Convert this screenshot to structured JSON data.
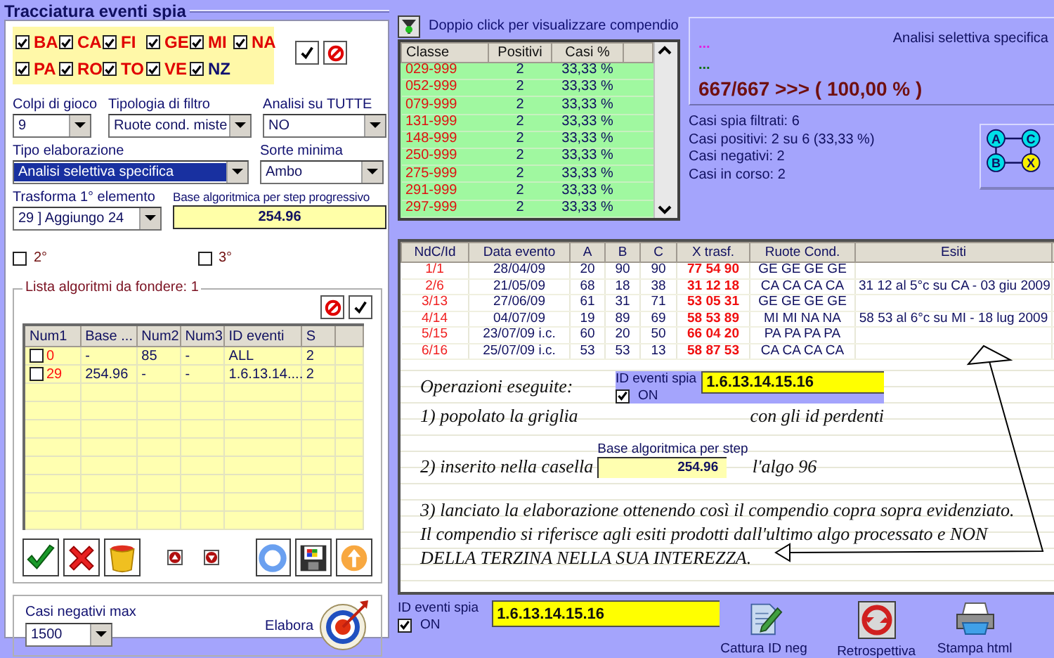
{
  "window": {
    "title": "Tracciatura eventi spia"
  },
  "wheels": [
    {
      "label": "BA",
      "checked": true,
      "color": "#e00000"
    },
    {
      "label": "CA",
      "checked": true,
      "color": "#e00000"
    },
    {
      "label": "FI",
      "checked": true,
      "color": "#e00000"
    },
    {
      "label": "GE",
      "checked": true,
      "color": "#e00000"
    },
    {
      "label": "MI",
      "checked": true,
      "color": "#e00000"
    },
    {
      "label": "NA",
      "checked": true,
      "color": "#e00000"
    },
    {
      "label": "PA",
      "checked": true,
      "color": "#e00000"
    },
    {
      "label": "RO",
      "checked": true,
      "color": "#e00000"
    },
    {
      "label": "TO",
      "checked": true,
      "color": "#e00000"
    },
    {
      "label": "VE",
      "checked": true,
      "color": "#e00000"
    },
    {
      "label": "NZ",
      "checked": true,
      "color": "#101070"
    }
  ],
  "filters": [
    {
      "label": "Colpi di gioco",
      "value": "9",
      "highlighted": false
    },
    {
      "label": "Tipologia di filtro",
      "value": "Ruote cond. miste",
      "highlighted": false
    },
    {
      "label": "Analisi su TUTTE",
      "value": "NO",
      "highlighted": false
    },
    {
      "label": "Tipo elaborazione",
      "value": "Analisi selettiva specifica",
      "highlighted": true
    },
    {
      "label": "Sorte minima",
      "value": "Ambo",
      "highlighted": false
    },
    {
      "label": "Trasforma 1° elemento",
      "value": "29 ] Aggiungo 24",
      "highlighted": false
    }
  ],
  "base_step": {
    "label": "Base algoritmica per step progressivo",
    "value": "254.96"
  },
  "extra_checks": [
    {
      "label": "2°",
      "checked": false
    },
    {
      "label": "3°",
      "checked": false
    }
  ],
  "algo_list": {
    "title": "Lista algoritmi da fondere: 1",
    "columns": [
      "Num1",
      "Base ...",
      "Num2",
      "Num3",
      "ID eventi",
      "S"
    ],
    "rows": [
      {
        "checked": false,
        "cells": [
          "0",
          "-",
          "85",
          "-",
          "ALL",
          "2"
        ]
      },
      {
        "checked": false,
        "cells": [
          "29",
          "254.96",
          "-",
          "-",
          "1.6.13.14....",
          "2"
        ]
      }
    ]
  },
  "casi_negativi": {
    "label": "Casi negativi max",
    "value": "1500"
  },
  "elabora": {
    "label": "Elabora"
  },
  "hint": "Doppio click per visualizzare compendio",
  "classes": {
    "columns": [
      "Classe",
      "Positivi",
      "Casi %"
    ],
    "rows": [
      [
        "029-999",
        "2",
        "33,33 %"
      ],
      [
        "052-999",
        "2",
        "33,33 %"
      ],
      [
        "079-999",
        "2",
        "33,33 %"
      ],
      [
        "131-999",
        "2",
        "33,33 %"
      ],
      [
        "148-999",
        "2",
        "33,33 %"
      ],
      [
        "250-999",
        "2",
        "33,33 %"
      ],
      [
        "275-999",
        "2",
        "33,33 %"
      ],
      [
        "291-999",
        "2",
        "33,33 %"
      ],
      [
        "297-999",
        "2",
        "33,33 %"
      ]
    ]
  },
  "summary": {
    "mode": "Analisi selettiva specifica",
    "line1": "...",
    "line2": "...",
    "ratio": "667/667 >>> ( 100,00 % )"
  },
  "stats": [
    "Casi spia filtrati: 6",
    "Casi positivi: 2 su 6 (33,33 %)",
    "Casi negativi: 2",
    "Casi in corso: 2"
  ],
  "diagram": {
    "nodes": [
      {
        "label": "A",
        "color": "#00e0e8"
      },
      {
        "label": "C",
        "color": "#00e0e8"
      },
      {
        "label": "B",
        "color": "#00e0e8"
      },
      {
        "label": "X",
        "color": "#f8f000"
      }
    ]
  },
  "events": {
    "columns": [
      "NdC/Id",
      "Data evento",
      "A",
      "B",
      "C",
      "X trasf.",
      "Ruote Cond.",
      "Esiti"
    ],
    "rows": [
      [
        "1/1",
        "28/04/09",
        "20",
        "90",
        "90",
        "77 54 90",
        "GE GE GE GE",
        ""
      ],
      [
        "2/6",
        "21/05/09",
        "68",
        "18",
        "38",
        "31 12 18",
        "CA CA CA CA",
        "31 12 al 5°c su CA - 03 giu 2009"
      ],
      [
        "3/13",
        "27/06/09",
        "61",
        "31",
        "71",
        "53 05 31",
        "GE GE GE GE",
        ""
      ],
      [
        "4/14",
        "04/07/09",
        "19",
        "89",
        "69",
        "58 53 89",
        "MI MI NA NA",
        "58 53 al 6°c su MI - 18 lug 2009"
      ],
      [
        "5/15",
        "23/07/09 i.c.",
        "60",
        "20",
        "50",
        "66 04 20",
        "PA PA PA PA",
        ""
      ],
      [
        "6/16",
        "25/07/09 i.c.",
        "53",
        "53",
        "13",
        "58 87 53",
        "CA CA CA CA",
        ""
      ]
    ]
  },
  "notes": {
    "heading": "Operazioni eseguite:",
    "step1": "1) popolato la griglia",
    "step1_tail": "con gli id perdenti",
    "step2": "2) inserito nella casella",
    "step2_tail": "l'algo 96",
    "step3_lines": [
      "3) lanciato la elaborazione ottenendo così il compendio copra sopra evidenziato.",
      "Il compendio si riferisce agli esiti prodotti dall'ultimo algo processato e NON",
      "DELLA TERZINA NELLA SUA INTEREZZA."
    ],
    "id_field": {
      "label": "ID eventi spia",
      "value": "1.6.13.14.15.16",
      "on_label": "ON",
      "checked": true
    },
    "base_field": {
      "label": "Base algoritmica per step",
      "value": "254.96"
    }
  },
  "bottom": {
    "id_field": {
      "label": "ID eventi spia",
      "value": "1.6.13.14.15.16",
      "on_label": "ON",
      "checked": true
    },
    "buttons": [
      {
        "label": "Cattura ID neg",
        "kind": "capture"
      },
      {
        "label": "Retrospettiva",
        "kind": "refresh"
      },
      {
        "label": "Stampa html",
        "kind": "print"
      }
    ]
  }
}
